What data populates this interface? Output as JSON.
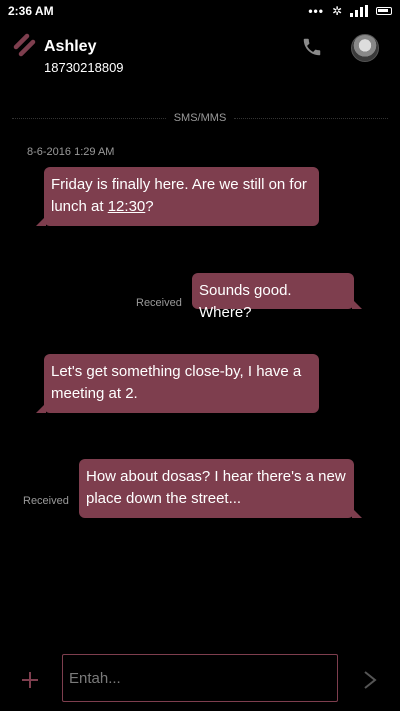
{
  "status_bar": {
    "time": "2:36 AM",
    "icons": [
      "dots-icon",
      "settings-icon",
      "signal-icon",
      "battery-icon"
    ]
  },
  "header": {
    "contact_name": "Ashley",
    "contact_number": "18730218809"
  },
  "divider_label": "SMS/MMS",
  "timestamp": "8-6-2016 1:29 AM",
  "messages": [
    {
      "direction": "incoming",
      "text_before_link": "Friday is finally here. Are we still on for lunch at ",
      "link": "12:30",
      "text_after_link": "?"
    },
    {
      "direction": "outgoing",
      "status": "Received",
      "text": "Sounds good. Where?"
    },
    {
      "direction": "incoming",
      "text": "Let's get something close-by, I have a meeting at 2."
    },
    {
      "direction": "outgoing",
      "status": "Received",
      "text": "How about dosas? I hear there's a new place down the street..."
    }
  ],
  "composer": {
    "placeholder": "Entah..."
  },
  "colors": {
    "bubble": "#7e3e4e",
    "accent": "#7e3e4e",
    "background": "#000000"
  }
}
